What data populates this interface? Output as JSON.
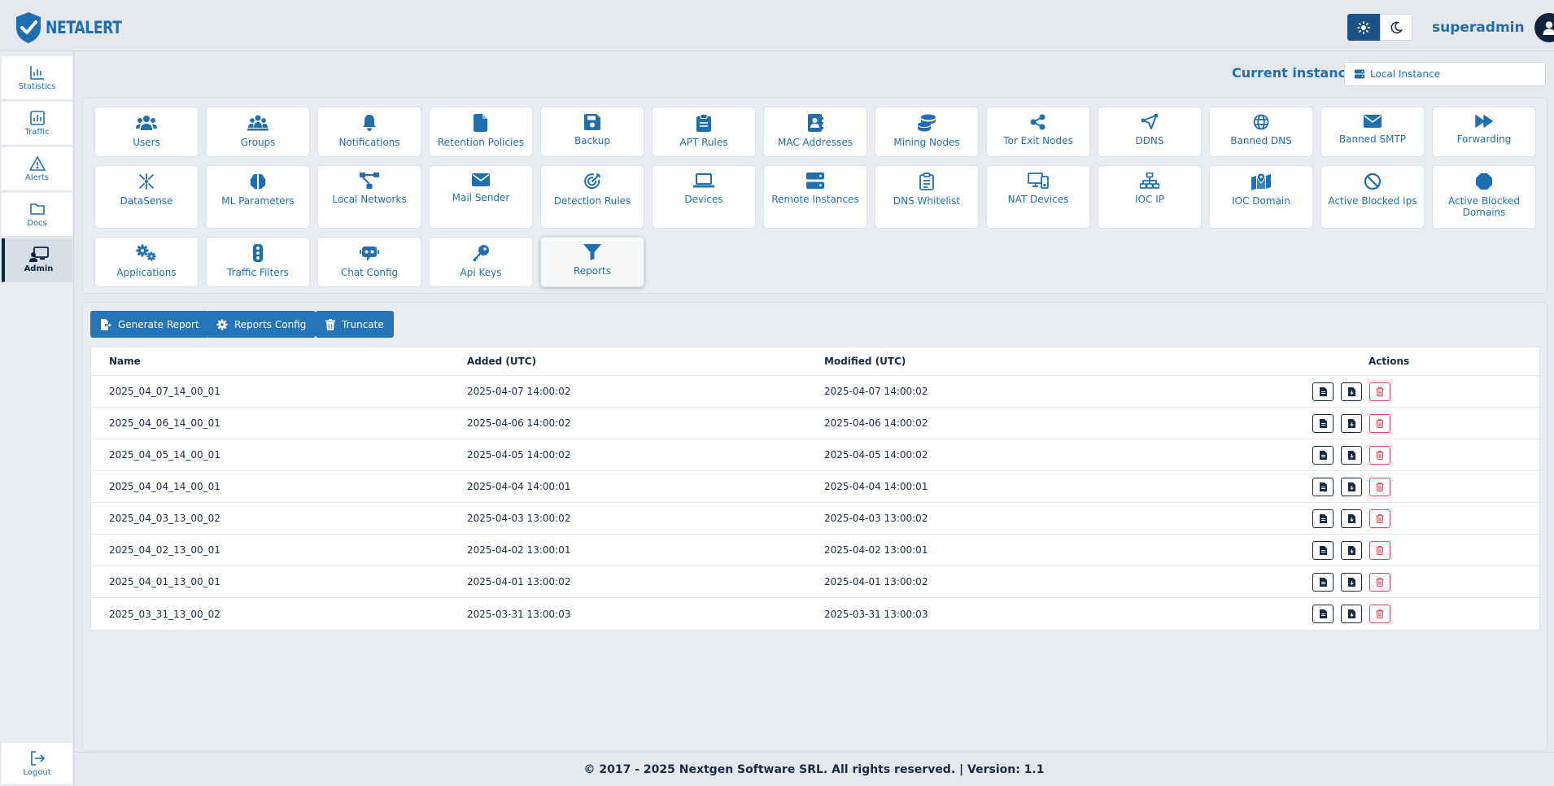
{
  "app": {
    "brand": "NETALERT"
  },
  "header": {
    "username": "superadmin"
  },
  "sidebar": {
    "items": [
      {
        "label": "Statistics",
        "icon": "chart-bar-icon"
      },
      {
        "label": "Traffic",
        "icon": "chart-square-icon"
      },
      {
        "label": "Alerts",
        "icon": "warning-triangle-icon"
      },
      {
        "label": "Docs",
        "icon": "folder-icon"
      },
      {
        "label": "Admin",
        "icon": "admin-screen-icon",
        "active": true
      }
    ],
    "logout": {
      "label": "Logout",
      "icon": "logout-icon"
    }
  },
  "instance": {
    "label": "Current instance:",
    "value": "Local Instance"
  },
  "tiles": [
    {
      "label": "Users",
      "icon": "users-icon"
    },
    {
      "label": "Groups",
      "icon": "groups-icon"
    },
    {
      "label": "Notifications",
      "icon": "bell-icon"
    },
    {
      "label": "Retention Policies",
      "icon": "file-icon"
    },
    {
      "label": "Backup",
      "icon": "save-icon"
    },
    {
      "label": "APT Rules",
      "icon": "clipboard-icon"
    },
    {
      "label": "MAC Addresses",
      "icon": "address-book-icon"
    },
    {
      "label": "Mining Nodes",
      "icon": "coins-icon"
    },
    {
      "label": "Tor Exit Nodes",
      "icon": "share-icon"
    },
    {
      "label": "DDNS",
      "icon": "send-icon"
    },
    {
      "label": "Banned DNS",
      "icon": "globe-icon"
    },
    {
      "label": "Banned SMTP",
      "icon": "envelope-icon"
    },
    {
      "label": "Forwarding",
      "icon": "forward-icon"
    },
    {
      "label": "DataSense",
      "icon": "sparkle-icon"
    },
    {
      "label": "ML Parameters",
      "icon": "brain-icon"
    },
    {
      "label": "Local Networks",
      "icon": "network-icon"
    },
    {
      "label": "Mail Sender",
      "icon": "envelope-icon"
    },
    {
      "label": "Detection Rules",
      "icon": "bullseye-icon"
    },
    {
      "label": "Devices",
      "icon": "laptop-icon"
    },
    {
      "label": "Remote Instances",
      "icon": "server-icon"
    },
    {
      "label": "DNS Whitelist",
      "icon": "clipboard-list-icon"
    },
    {
      "label": "NAT Devices",
      "icon": "devices-icon"
    },
    {
      "label": "IOC IP",
      "icon": "sitemap-icon"
    },
    {
      "label": "IOC Domain",
      "icon": "map-marker-icon"
    },
    {
      "label": "Active Blocked Ips",
      "icon": "ban-icon"
    },
    {
      "label": "Active Blocked Domains",
      "icon": "octagon-icon"
    },
    {
      "label": "Applications",
      "icon": "gears-icon"
    },
    {
      "label": "Traffic Filters",
      "icon": "traffic-light-icon"
    },
    {
      "label": "Chat Config",
      "icon": "robot-icon"
    },
    {
      "label": "Api Keys",
      "icon": "key-icon"
    },
    {
      "label": "Reports",
      "icon": "filter-icon",
      "active": true
    }
  ],
  "toolbar": {
    "generate_label": "Generate Report",
    "config_label": "Reports Config",
    "truncate_label": "Truncate"
  },
  "table": {
    "headers": {
      "name": "Name",
      "added": "Added (UTC)",
      "modified": "Modified (UTC)",
      "actions": "Actions"
    },
    "rows": [
      {
        "name": "2025_04_07_14_00_01",
        "added": "2025-04-07 14:00:02",
        "modified": "2025-04-07 14:00:02"
      },
      {
        "name": "2025_04_06_14_00_01",
        "added": "2025-04-06 14:00:02",
        "modified": "2025-04-06 14:00:02"
      },
      {
        "name": "2025_04_05_14_00_01",
        "added": "2025-04-05 14:00:02",
        "modified": "2025-04-05 14:00:02"
      },
      {
        "name": "2025_04_04_14_00_01",
        "added": "2025-04-04 14:00:01",
        "modified": "2025-04-04 14:00:01"
      },
      {
        "name": "2025_04_03_13_00_02",
        "added": "2025-04-03 13:00:02",
        "modified": "2025-04-03 13:00:02"
      },
      {
        "name": "2025_04_02_13_00_01",
        "added": "2025-04-02 13:00:01",
        "modified": "2025-04-02 13:00:01"
      },
      {
        "name": "2025_04_01_13_00_01",
        "added": "2025-04-01 13:00:02",
        "modified": "2025-04-01 13:00:02"
      },
      {
        "name": "2025_03_31_13_00_02",
        "added": "2025-03-31 13:00:03",
        "modified": "2025-03-31 13:00:03"
      }
    ]
  },
  "footer": {
    "text": "© 2017 - 2025 Nextgen Software SRL. All rights reserved. | Version: 1.1"
  },
  "colors": {
    "primary": "#1f6fb0",
    "button": "#2474b8",
    "dark": "#0d2440",
    "danger": "#d9445a"
  }
}
